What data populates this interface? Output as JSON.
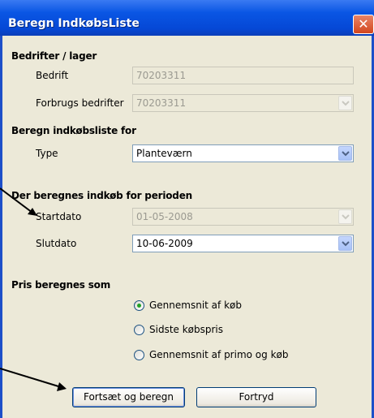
{
  "window": {
    "title": "Beregn IndkøbsListe"
  },
  "sections": {
    "bedrifter": "Bedrifter / lager",
    "beregn": "Beregn indkøbsliste for",
    "periode": "Der beregnes indkøb for perioden",
    "pris": "Pris beregnes som"
  },
  "fields": {
    "bedrift": {
      "label": "Bedrift",
      "value": "70203311"
    },
    "forbrugs": {
      "label": "Forbrugs bedrifter",
      "value": "70203311"
    },
    "type": {
      "label": "Type",
      "value": "Planteværn"
    },
    "startdato": {
      "label": "Startdato",
      "value": "01-05-2008"
    },
    "slutdato": {
      "label": "Slutdato",
      "value": "10-06-2009"
    }
  },
  "pricing": {
    "selected": "Gennemsnit af køb",
    "options": [
      "Gennemsnit af køb",
      "Sidste købspris",
      "Gennemsnit af primo og køb"
    ]
  },
  "buttons": {
    "continue": "Fortsæt og beregn",
    "cancel": "Fortryd"
  },
  "colors": {
    "titlebar": "#0548d6",
    "client": "#ece9d8",
    "close": "#d3461d"
  }
}
